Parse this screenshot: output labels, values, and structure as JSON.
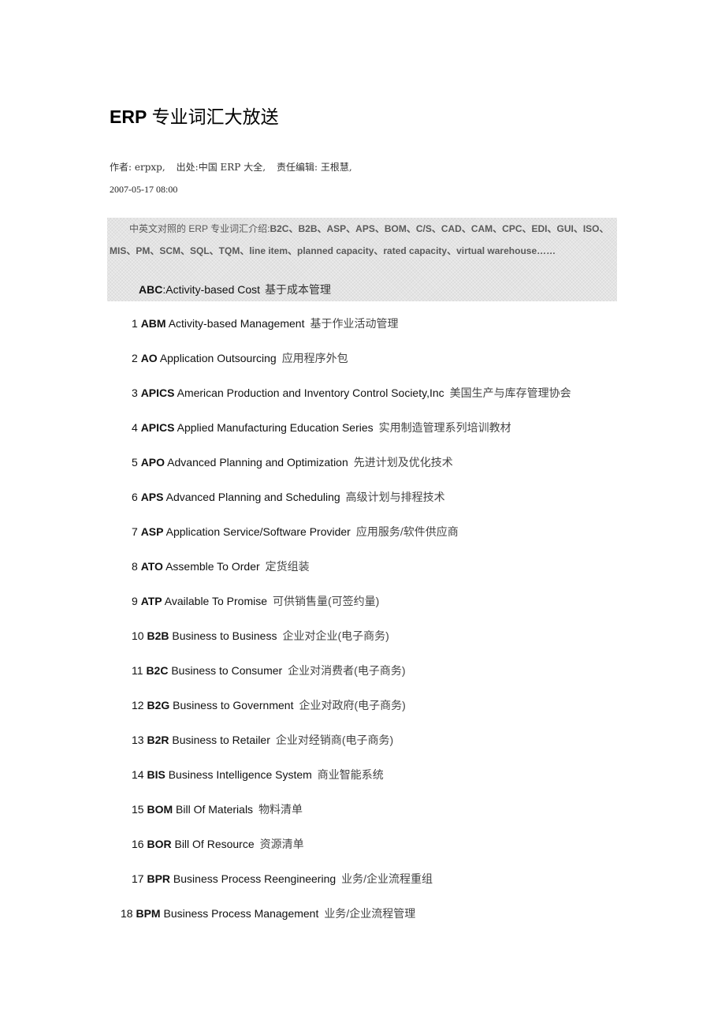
{
  "article": {
    "title_en": "ERP",
    "title_zh": " 专业词汇大放送",
    "meta": {
      "author": "作者: erpxp,",
      "source": "出处:中国 ERP 大全,",
      "editor": "责任编辑: 王根慧,"
    },
    "date": "2007-05-17 08:00"
  },
  "intro": {
    "line1_lead": "中英文对照的 ERP 专业词汇介绍:",
    "line1_terms": "B2C、B2B、ASP、APS、BOM、C/S、CAD、CAM、CPC、EDI、GUI、ISO、",
    "line2_terms": "MIS、PM、SCM、SQL、TQM、line item、planned capacity、rated capacity、virtual warehouse……",
    "abc": {
      "abbr": "ABC",
      "sep": ":",
      "en": "Activity-based Cost",
      "zh": "基于成本管理"
    }
  },
  "entries": [
    {
      "num": "1",
      "abbr": "ABM",
      "en": "Activity-based Management",
      "zh": "基于作业活动管理"
    },
    {
      "num": "2",
      "abbr": "AO",
      "en": "Application Outsourcing",
      "zh": "应用程序外包"
    },
    {
      "num": "3",
      "abbr": "APICS",
      "en": "American Production and Inventory Control Society,Inc",
      "zh": "美国生产与库存管理协会"
    },
    {
      "num": "4",
      "abbr": "APICS",
      "en": "Applied Manufacturing Education Series",
      "zh": "实用制造管理系列培训教材"
    },
    {
      "num": "5",
      "abbr": "APO",
      "en": "Advanced Planning and Optimization",
      "zh": "先进计划及优化技术"
    },
    {
      "num": "6",
      "abbr": "APS",
      "en": "Advanced Planning and Scheduling",
      "zh": "高级计划与排程技术"
    },
    {
      "num": "7",
      "abbr": "ASP",
      "en": "Application Service/Software Provider",
      "zh": "应用服务/软件供应商"
    },
    {
      "num": "8",
      "abbr": "ATO",
      "en": "Assemble To Order",
      "zh": "定货组装"
    },
    {
      "num": "9",
      "abbr": "ATP",
      "en": "Available To Promise",
      "zh": "可供销售量(可签约量)"
    },
    {
      "num": "10",
      "abbr": "B2B",
      "en": "Business to Business",
      "zh": "企业对企业(电子商务)"
    },
    {
      "num": "11",
      "abbr": "B2C",
      "en": "Business to Consumer",
      "zh": "企业对消费者(电子商务)"
    },
    {
      "num": "12",
      "abbr": "B2G",
      "en": "Business to Government",
      "zh": "企业对政府(电子商务)"
    },
    {
      "num": "13",
      "abbr": "B2R",
      "en": "Business to Retailer",
      "zh": "企业对经销商(电子商务)"
    },
    {
      "num": "14",
      "abbr": "BIS",
      "en": "Business Intelligence System",
      "zh": "商业智能系统"
    },
    {
      "num": "15",
      "abbr": "BOM",
      "en": "Bill Of Materials",
      "zh": "物料清单"
    },
    {
      "num": "16",
      "abbr": "BOR",
      "en": "Bill Of Resource",
      "zh": "资源清单"
    },
    {
      "num": "17",
      "abbr": "BPR",
      "en": "Business Process Reengineering",
      "zh": "业务/企业流程重组"
    },
    {
      "num": "18",
      "abbr": "BPM",
      "en": "Business Process Management",
      "zh": "业务/企业流程管理"
    }
  ]
}
